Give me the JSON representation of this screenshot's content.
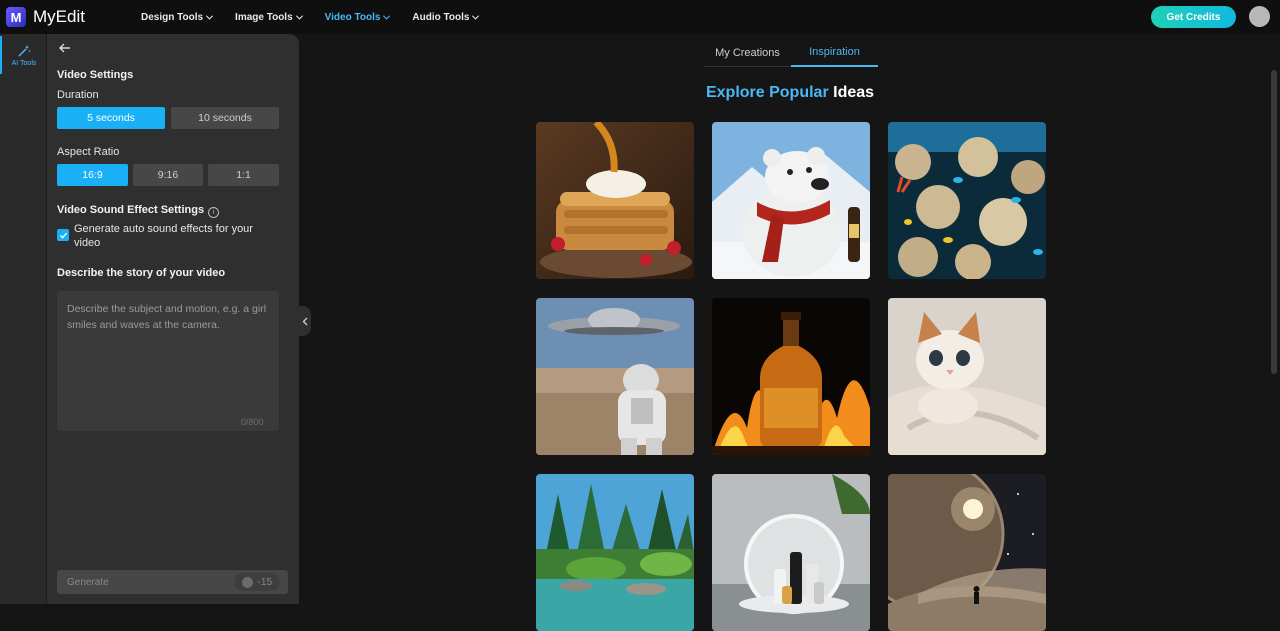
{
  "app": {
    "name": "MyEdit",
    "logo_letter": "M"
  },
  "nav": [
    {
      "label": "Design Tools",
      "active": false
    },
    {
      "label": "Image Tools",
      "active": false
    },
    {
      "label": "Video Tools",
      "active": true
    },
    {
      "label": "Audio Tools",
      "active": false
    }
  ],
  "header": {
    "credits_label": "Get Credits"
  },
  "rail": {
    "ai_tools_label": "AI Tools"
  },
  "panel": {
    "title": "Video Settings",
    "duration_label": "Duration",
    "duration_options": [
      "5 seconds",
      "10 seconds"
    ],
    "duration_selected": "5 seconds",
    "aspect_label": "Aspect Ratio",
    "aspect_options": [
      "16:9",
      "9:16",
      "1:1"
    ],
    "aspect_selected": "16:9",
    "sound_title": "Video Sound Effect Settings",
    "sound_checkbox_label": "Generate auto sound effects for your video",
    "sound_checked": true,
    "story_title": "Describe the story of your video",
    "story_placeholder": "Describe the subject and motion, e.g. a girl smiles and waves at the camera.",
    "story_value": "",
    "counter": "0/800",
    "generate_label": "Generate",
    "generate_cost": "-15"
  },
  "main": {
    "tabs": [
      {
        "label": "My Creations",
        "active": false
      },
      {
        "label": "Inspiration",
        "active": true
      }
    ],
    "heading_highlight": "Explore Popular",
    "heading_rest": " Ideas"
  },
  "colors": {
    "accent": "#1ab0f5",
    "accent_text": "#4ab8f5",
    "credits_start": "#1fd1b8",
    "credits_end": "#12b8dd"
  }
}
